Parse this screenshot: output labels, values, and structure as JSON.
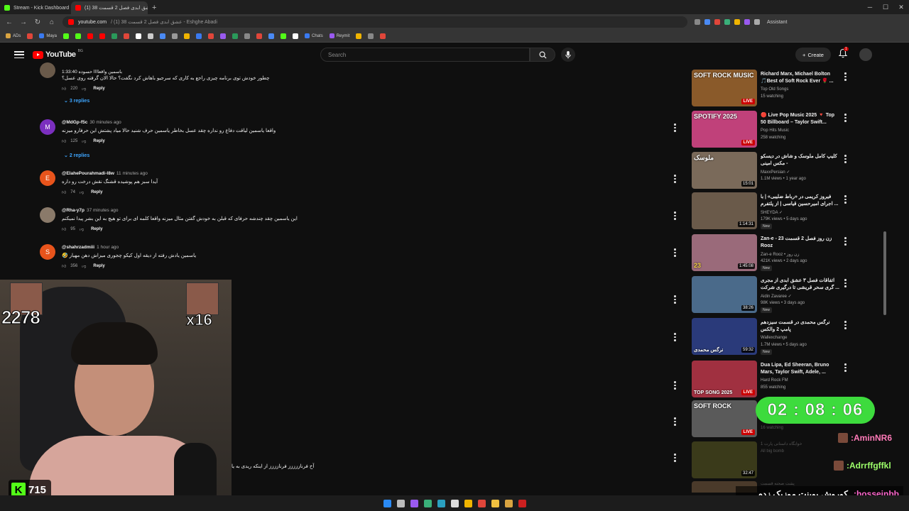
{
  "browser": {
    "tabs": [
      {
        "title": "Stream - Kick Dashboard",
        "color": "#53fc18"
      },
      {
        "title": "(1) 38 عشق ابدی فصل 2 قسمت",
        "color": "#ff0000"
      }
    ],
    "new_tab": "+",
    "url_host": "youtube.com",
    "url_rest": "/ (1) 38 عشق ابدی فصل 2 قسمت - Eshghe Abadi",
    "assistant": "Assistant",
    "bookmarks": [
      "ADs",
      "Maya",
      "Chats",
      "Reymit"
    ]
  },
  "youtube": {
    "logo": "YouTube",
    "logo_cc": "BG",
    "search_placeholder": "Search",
    "create": "Create",
    "notif_count": "1"
  },
  "comments": [
    {
      "handle": "",
      "time": "",
      "text": "چطور خودش توی برنامه چیزی راجع به کاری که سرجیو باهاش کرد نگفت؟ حالا الان گرفته روی عسل؟",
      "sub": "باسمین واقعاااا حسوده 1:33:40",
      "likes": "220",
      "reply": "Reply",
      "replies": "3 replies"
    },
    {
      "handle": "@MdGp-f5c",
      "time": "30 minutes ago",
      "text": "واقعا یاسمین لیاقت دفاع رو نداره چقد عسل بخاطر یاسمین حرف شنید حالا میاد پشتش این حرفارو میزنه",
      "likes": "125",
      "reply": "Reply",
      "replies": "2 replies",
      "initial": "M"
    },
    {
      "handle": "@ElahePourahmadi-l8w",
      "time": "11 minutes ago",
      "text": "آیدا سبز هم پوشیده قشنگ نقش درخت رو داره",
      "likes": "74",
      "reply": "Reply",
      "initial": "E"
    },
    {
      "handle": "@Rha-y7p",
      "time": "37 minutes ago",
      "text": "این یاسمین چقد چندشه حرفای که قبلن به خودش گفتن مثال میزنه واقعا کلمه ای برای تو هیچ به این بشر پیدا نمیکنم",
      "likes": "95",
      "reply": "Reply"
    },
    {
      "handle": "@shahrzadmiii",
      "time": "1 hour ago",
      "text": "یاسمین یادش رفته از دیقه اول کیکو چجوری میزاش دهن مهیار 🤣",
      "likes": "356",
      "reply": "Reply",
      "initial": "S"
    }
  ],
  "bottom_comment": "آخ فرناززززز فرنازززز از اینکه ریدی به یا",
  "related": [
    {
      "title": "Richard Marx, Michael Bolton 🎵Best of Soft Rock Ever 🌹 ...",
      "channel": "Top Old Songs",
      "meta": "15 watching",
      "badge": "LIVE",
      "thumb_label": "SOFT ROCK MUSIC",
      "bg": "#8a5a2a"
    },
    {
      "title": "🔴 Live Pop Music 2025 🔻 Top 50 Billboard – Taylor Swift...",
      "channel": "Pop Hits Music",
      "meta": "258 watching",
      "badge": "LIVE",
      "thumb_label": "SPOTIFY 2025",
      "bg": "#c0417a"
    },
    {
      "title": "کلیپ کامل ملوسک و شاش در دیسکو - مکس امینی",
      "channel": "MaxxPersian ✓",
      "meta": "1.1M views • 1 year ago",
      "badge": "15:01",
      "thumb_label": "ملوسک",
      "bg": "#7a6a5a"
    },
    {
      "title": "فیروز کریمی در «رباط ضلیبی» | با اجرای امیرحسین قیاسی | از پلتفرم ...",
      "channel": "SHEYDA ✓",
      "meta": "179K views • 5 days ago",
      "new": "New",
      "badge": "1:14:31",
      "thumb_label": "",
      "bg": "#6a5a4a"
    },
    {
      "title": "Zan-e - 23 زن روز فصل 2 قسمت Rooz",
      "channel": "Zan-e Rooz • زن روز",
      "meta": "421K views • 2 days ago",
      "new": "New",
      "badge": "1:45:08",
      "thumb_label": "23",
      "bg": "#9a6a7a"
    },
    {
      "title": "اتفاقات فصل ۳ عشق ابدی از مجری گری سحر قریشی تا درگیری شرکت ...",
      "channel": "Aidin Zavaree ✓",
      "meta": "98K views • 3 days ago",
      "new": "New",
      "badge": "38:26",
      "thumb_label": "",
      "bg": "#4a6a8a"
    },
    {
      "title": "نرگس محمدی در قسمت سیزدهم پامپ 2 والکس",
      "channel": "Wallexchange",
      "meta": "1.7M views • 5 days ago",
      "new": "New",
      "badge": "59:32",
      "thumb_label": "نرگس محمدی",
      "bg": "#2a3a7a"
    },
    {
      "title": "Dua Lipa, Ed Sheeran, Bruno Mars, Taylor Swift, Adele, ...",
      "channel": "Hard Rock FM",
      "meta": "855 watching",
      "badge": "LIVE",
      "thumb_label": "TOP SONG 2025",
      "bg": "#a03040"
    },
    {
      "title": "",
      "channel": "",
      "meta": "",
      "badge": "LIVE",
      "thumb_label": "SOFT ROCK",
      "bg": "#5a5a5a"
    },
    {
      "title": "خوابگاه داستانی پارت 1",
      "channel": "",
      "meta": "",
      "badge": "32:47",
      "thumb_label": "",
      "bg": "#3a3a1a"
    },
    {
      "title": "پشت صحنه قسمت",
      "channel": "",
      "meta": "",
      "badge": "",
      "thumb_label": "",
      "bg": "#4a3a2a"
    }
  ],
  "faded": {
    "item9_meta": "16 watching",
    "item10_title": "خوابگاه داستانی پارت 1",
    "item10_chan": "All big bomb",
    "item11_title": "پشت صحنه قسمت"
  },
  "stream": {
    "big_count": "2278",
    "combo": "x16",
    "kick_viewers": "715",
    "timer": "02 : 08 : 06",
    "chat": [
      {
        "user": ":AminNR6"
      },
      {
        "user": ":Adrrffgffkl"
      },
      {
        "user": ":hosseinbb",
        "message": "کوروش پوینت موزیک زدم"
      }
    ]
  },
  "colors": {
    "yt_red": "#ff0000",
    "link_blue": "#3ea6ff",
    "kick_green": "#53fc18",
    "timer_green": "#3ddb3d"
  }
}
